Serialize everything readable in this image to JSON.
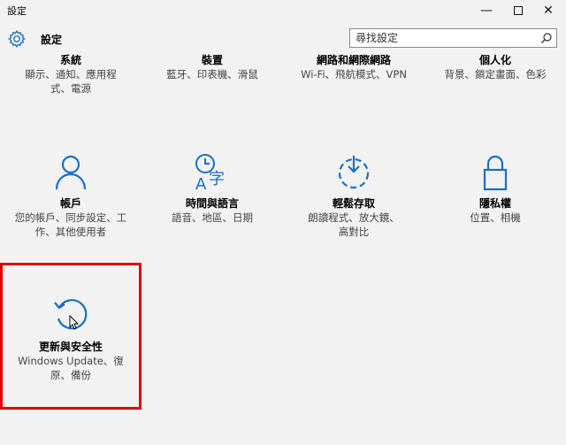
{
  "window": {
    "title": "設定",
    "minimize": "—",
    "maximize": "☐",
    "close": "✕"
  },
  "header": {
    "app_title": "設定",
    "search_placeholder": "尋找設定"
  },
  "accent": "#1a6fc4",
  "highlight_color": "#e00000",
  "categories": [
    {
      "name": "系統",
      "desc": "顯示、通知、應用程式、電源",
      "icon": "system-icon"
    },
    {
      "name": "裝置",
      "desc": "藍牙、印表機、滑鼠",
      "icon": "devices-icon"
    },
    {
      "name": "網路和網際網路",
      "desc": "Wi-Fi、飛航模式、VPN",
      "icon": "network-icon"
    },
    {
      "name": "個人化",
      "desc": "背景、鎖定畫面、色彩",
      "icon": "personalization-icon"
    },
    {
      "name": "帳戶",
      "desc": "您的帳戶、同步設定、工作、其他使用者",
      "icon": "person-icon"
    },
    {
      "name": "時間與語言",
      "desc": "語音、地區、日期",
      "icon": "time-language-icon"
    },
    {
      "name": "輕鬆存取",
      "desc": "朗讀程式、放大鏡、高對比",
      "icon": "ease-of-access-icon"
    },
    {
      "name": "隱私權",
      "desc": "位置、相機",
      "icon": "lock-icon"
    },
    {
      "name": "更新與安全性",
      "desc": "Windows Update、復原、備份",
      "icon": "update-icon"
    }
  ]
}
